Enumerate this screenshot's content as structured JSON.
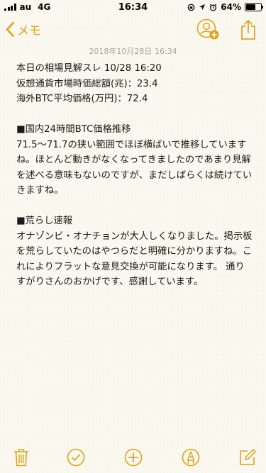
{
  "status": {
    "carrier": "au",
    "network": "4G",
    "time": "16:34",
    "battery_percent": "64%",
    "battery_level": 0.64
  },
  "nav": {
    "back_label": "メモ",
    "icons": [
      "chevron-left-icon",
      "add-person-icon",
      "share-icon"
    ],
    "accent": "#e0a21b"
  },
  "note": {
    "timestamp": "2018年10月28日 16:34",
    "lines": [
      "本日の相場見解スレ 10/28 16:20",
      "仮想通貨市場時価総額(兆)：23.4",
      "海外BTC平均価格(万円)：72.4",
      "",
      "■国内24時間BTC価格推移",
      "71.5～71.7の狭い範囲でほぼ横ばいで推移していますね。ほとんど動きがなくなってきましたのであまり見解を述べる意味もないのですが、まだしばらくは続けていきますね。",
      "",
      "■荒らし速報",
      "オナゾンビ・オナチョンが大人しくなりました。掲示板を荒らしていたのはやつらだと明確に分かりますね。これによりフラットな意見交換が可能になります。 通りすがりさんのおかげです、感謝しています。"
    ]
  },
  "toolbar": {
    "icons": [
      "trash-icon",
      "checklist-icon",
      "add-icon",
      "markup-icon",
      "compose-icon"
    ]
  }
}
